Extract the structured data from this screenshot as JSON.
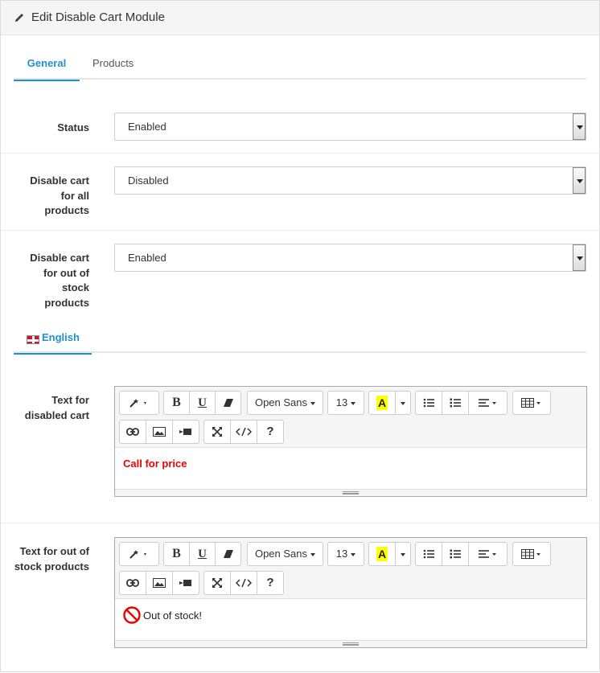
{
  "header": {
    "title": "Edit Disable Cart Module",
    "icon": "pencil-icon"
  },
  "tabs": [
    {
      "label": "General",
      "active": true
    },
    {
      "label": "Products",
      "active": false
    }
  ],
  "fields": {
    "status": {
      "label": "Status",
      "value": "Enabled"
    },
    "disable_all": {
      "label": "Disable cart for all products",
      "value": "Disabled"
    },
    "disable_oos": {
      "label": "Disable cart for out of stock products",
      "value": "Enabled"
    }
  },
  "language_tab": {
    "label": "English",
    "flag": "uk-flag-icon"
  },
  "editors": {
    "disabled_cart": {
      "label": "Text for disabled cart",
      "content": "Call for price",
      "content_color": "#e00000"
    },
    "out_of_stock": {
      "label": "Text for out of stock products",
      "content": "Out of stock!",
      "content_icon": "no-entry-icon"
    }
  },
  "toolbar": {
    "font_family": "Open Sans",
    "font_size": "13",
    "highlight_letter": "A",
    "bold": "B",
    "underline": "U",
    "help": "?"
  },
  "colors": {
    "accent": "#1e91cf",
    "heading_bg": "#f5f5f5",
    "highlight": "#ffff00",
    "red": "#e00000"
  }
}
